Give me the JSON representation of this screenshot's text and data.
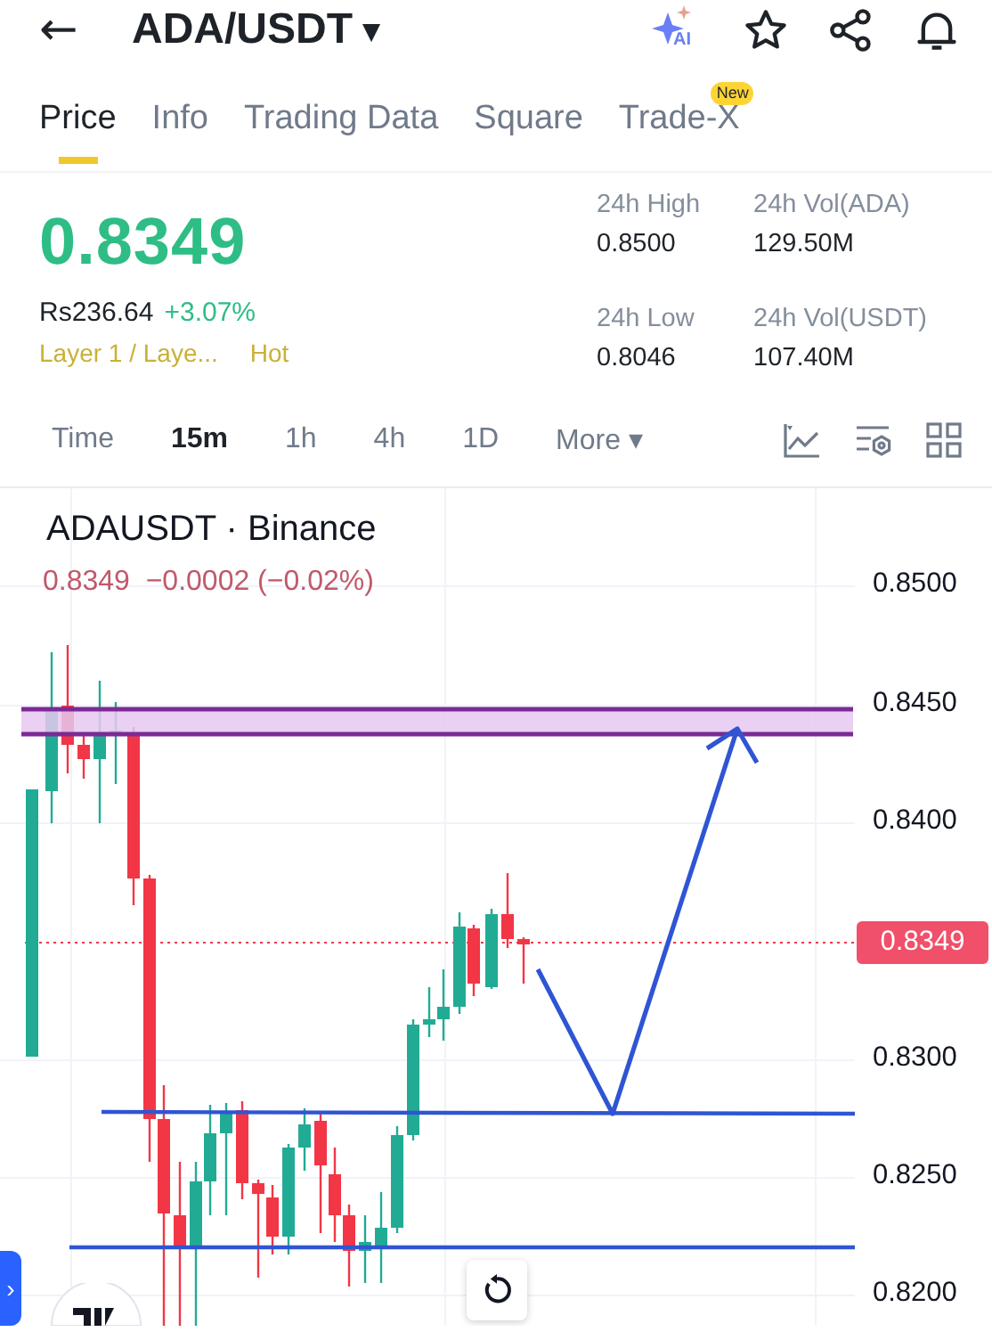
{
  "header": {
    "back": "←",
    "title": "ADA/USDT",
    "caret": "▾",
    "ai_label": "AI"
  },
  "tabs": [
    {
      "label": "Price",
      "selected": true
    },
    {
      "label": "Info",
      "selected": false
    },
    {
      "label": "Trading Data",
      "selected": false
    },
    {
      "label": "Square",
      "selected": false
    },
    {
      "label": "Trade-X",
      "selected": false,
      "badge": "New"
    }
  ],
  "ticker": {
    "price": "0.8349",
    "fiat": "Rs236.64",
    "change": "+3.07%",
    "category": "Layer 1 / Laye...",
    "tag": "Hot",
    "stats": [
      {
        "label": "24h High",
        "value": "0.8500"
      },
      {
        "label": "24h Vol(ADA)",
        "value": "129.50M"
      },
      {
        "label": "24h Low",
        "value": "0.8046"
      },
      {
        "label": "24h Vol(USDT)",
        "value": "107.40M"
      }
    ]
  },
  "intervals": [
    {
      "label": "Time",
      "selected": false
    },
    {
      "label": "15m",
      "selected": true
    },
    {
      "label": "1h",
      "selected": false
    },
    {
      "label": "4h",
      "selected": false
    },
    {
      "label": "1D",
      "selected": false
    },
    {
      "label": "More",
      "selected": false,
      "caret": "▾"
    }
  ],
  "chart": {
    "symbol": "ADAUSDT · Binance",
    "quote": "0.8349  −0.0002 (−0.02%)",
    "price_axis": [
      "0.8500",
      "0.8450",
      "0.8400",
      "0.8300",
      "0.8250",
      "0.8200"
    ],
    "last_price": "0.8349",
    "drawer_toggle": "›"
  }
}
